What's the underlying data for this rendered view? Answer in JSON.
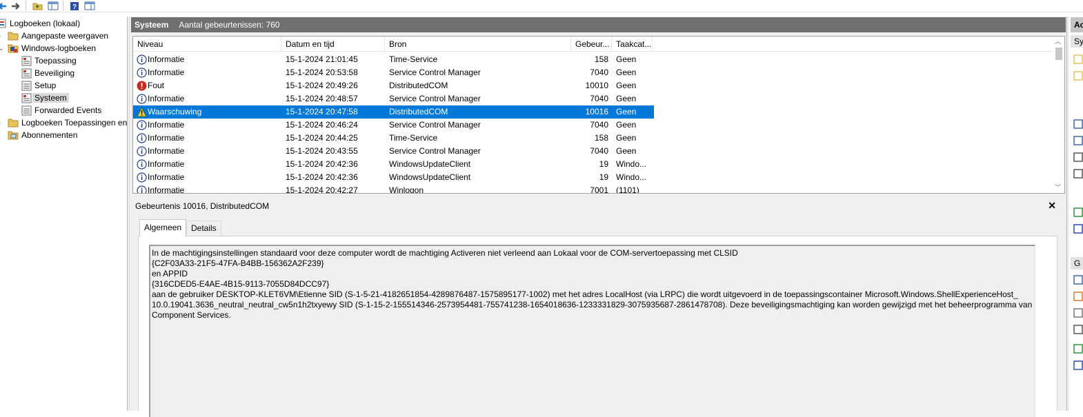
{
  "toolbar": {
    "buttons": [
      "back-icon",
      "forward-icon",
      "folder-up-icon",
      "show-hide-tree-icon",
      "help-icon",
      "show-hide-action-pane-icon"
    ]
  },
  "tree": {
    "root": "Logboeken (lokaal)",
    "items": [
      {
        "label": "Aangepaste weergaven",
        "icon": "folder-icon"
      },
      {
        "label": "Windows-logboeken",
        "icon": "windows-logs-icon"
      },
      {
        "label": "Toepassing",
        "icon": "log-icon"
      },
      {
        "label": "Beveiliging",
        "icon": "log-icon"
      },
      {
        "label": "Setup",
        "icon": "log-icon"
      },
      {
        "label": "Systeem",
        "icon": "log-icon"
      },
      {
        "label": "Forwarded Events",
        "icon": "log-icon"
      },
      {
        "label": "Logboeken Toepassingen en",
        "icon": "folder-icon"
      },
      {
        "label": "Abonnementen",
        "icon": "subscriptions-icon"
      }
    ]
  },
  "header": {
    "title": "Systeem",
    "count": "Aantal gebeurtenissen: 760"
  },
  "grid": {
    "columns": [
      "Niveau",
      "Datum en tijd",
      "Bron",
      "Gebeur...",
      "Taakcat..."
    ],
    "rows": [
      {
        "level": "Informatie",
        "type": "info",
        "datetime": "15-1-2024 21:01:45",
        "source": "Time-Service",
        "id": "158",
        "task": "Geen"
      },
      {
        "level": "Informatie",
        "type": "info",
        "datetime": "15-1-2024 20:53:58",
        "source": "Service Control Manager",
        "id": "7040",
        "task": "Geen"
      },
      {
        "level": "Fout",
        "type": "error",
        "datetime": "15-1-2024 20:49:26",
        "source": "DistributedCOM",
        "id": "10010",
        "task": "Geen"
      },
      {
        "level": "Informatie",
        "type": "info",
        "datetime": "15-1-2024 20:48:57",
        "source": "Service Control Manager",
        "id": "7040",
        "task": "Geen"
      },
      {
        "level": "Waarschuwing",
        "type": "warning",
        "datetime": "15-1-2024 20:47:58",
        "source": "DistributedCOM",
        "id": "10016",
        "task": "Geen"
      },
      {
        "level": "Informatie",
        "type": "info",
        "datetime": "15-1-2024 20:46:24",
        "source": "Service Control Manager",
        "id": "7040",
        "task": "Geen"
      },
      {
        "level": "Informatie",
        "type": "info",
        "datetime": "15-1-2024 20:44:25",
        "source": "Time-Service",
        "id": "158",
        "task": "Geen"
      },
      {
        "level": "Informatie",
        "type": "info",
        "datetime": "15-1-2024 20:43:55",
        "source": "Service Control Manager",
        "id": "7040",
        "task": "Geen"
      },
      {
        "level": "Informatie",
        "type": "info",
        "datetime": "15-1-2024 20:42:36",
        "source": "WindowsUpdateClient",
        "id": "19",
        "task": "Windo..."
      },
      {
        "level": "Informatie",
        "type": "info",
        "datetime": "15-1-2024 20:42:36",
        "source": "WindowsUpdateClient",
        "id": "19",
        "task": "Windo..."
      },
      {
        "level": "Informatie",
        "type": "info",
        "datetime": "15-1-2024 20:42:27",
        "source": "Winlogon",
        "id": "7001",
        "task": "(1101)"
      }
    ]
  },
  "detail": {
    "title": "Gebeurtenis 10016, DistributedCOM",
    "close": "✕",
    "tabs": [
      "Algemeen",
      "Details"
    ],
    "message_lines": [
      "In de machtigingsinstellingen standaard voor deze computer wordt de machtiging Activeren niet verleend aan Lokaal voor de COM-servertoepassing met CLSID",
      "{C2F03A33-21F5-47FA-B4BB-156362A2F239}",
      " en APPID",
      "{316CDED5-E4AE-4B15-9113-7055D84DCC97}",
      " aan de gebruiker DESKTOP-KLET6VM\\Etienne SID (S-1-5-21-4182651854-4289876487-1575895177-1002) met het adres LocalHost (via LRPC) die wordt uitgevoerd in de toepassingscontainer Microsoft.Windows.ShellExperienceHost_",
      "10.0.19041.3636_neutral_neutral_cw5n1h2txyewy SID (S-1-15-2-155514346-2573954481-755741238-1654018636-1233331829-3075935687-2861478708). Deze beveiligingsmachtiging kan worden gewijzigd met het beheerprogramma van",
      "Component Services."
    ]
  },
  "actions": {
    "title": "Ac",
    "subheader": "Sy",
    "subheader2": "G",
    "icons": [
      "open-icon",
      "filter-icon",
      "funnel-icon",
      "properties-icon",
      "find-icon",
      "save-icon",
      "refresh-icon",
      "help-icon",
      "event-properties-icon",
      "task-icon",
      "copy-icon",
      "save-event-icon",
      "refresh-icon",
      "help-icon"
    ]
  },
  "colors": {
    "selection": "#0078d7",
    "header_bar": "#707070",
    "info_icon": "#1e3f8c",
    "error_icon": "#c42b1c",
    "warning_icon": "#2f6b2f"
  }
}
